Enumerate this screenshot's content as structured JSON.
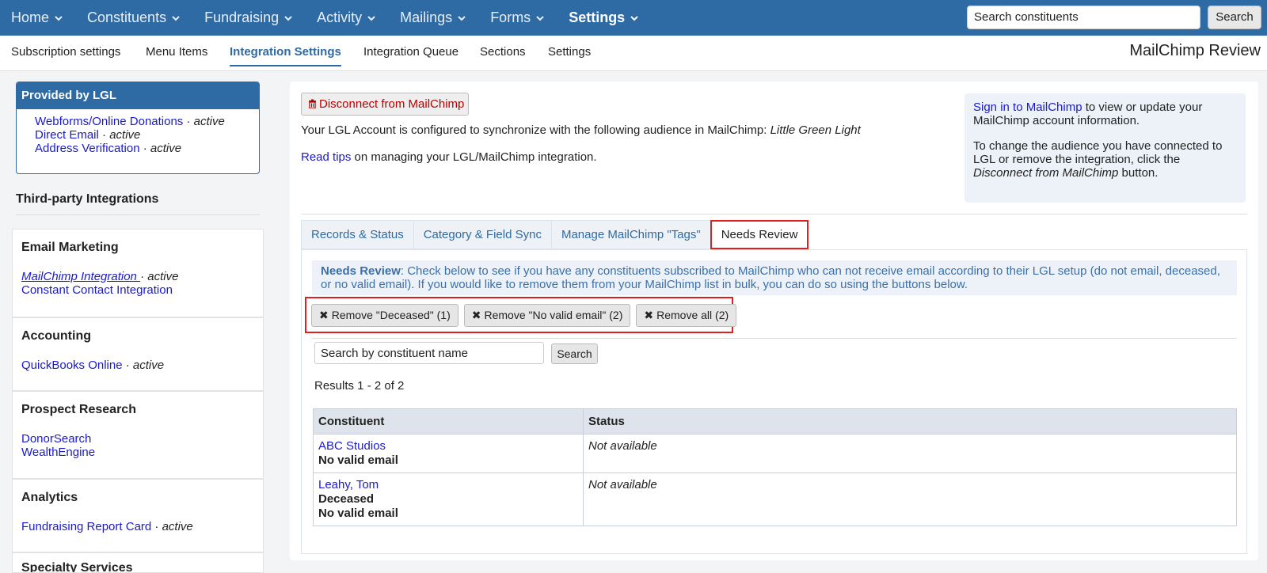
{
  "topnav": {
    "items": [
      {
        "label": "Home"
      },
      {
        "label": "Constituents"
      },
      {
        "label": "Fundraising"
      },
      {
        "label": "Activity"
      },
      {
        "label": "Mailings"
      },
      {
        "label": "Forms"
      },
      {
        "label": "Settings"
      }
    ],
    "search_value": "Search constituents",
    "search_button": "Search"
  },
  "subnav": {
    "items": [
      {
        "label": "Subscription settings"
      },
      {
        "label": "Menu Items"
      },
      {
        "label": "Integration Settings"
      },
      {
        "label": "Integration Queue"
      },
      {
        "label": "Sections"
      },
      {
        "label": "Settings"
      }
    ],
    "page_title": "MailChimp Review"
  },
  "sidebar": {
    "provided": {
      "title": "Provided by LGL",
      "items": [
        {
          "name": "Webforms/Online Donations",
          "sep": " · ",
          "state": "active"
        },
        {
          "name": "Direct Email",
          "sep": " · ",
          "state": "active"
        },
        {
          "name": "Address Verification",
          "sep": " · ",
          "state": "active"
        }
      ]
    },
    "third_party_title": "Third-party Integrations",
    "panels": [
      {
        "title": "Email Marketing",
        "items": [
          {
            "name": "MailChimp Integration ",
            "sep": "· ",
            "state": "active"
          },
          {
            "name": "Constant Contact Integration",
            "sep": "",
            "state": ""
          }
        ]
      },
      {
        "title": "Accounting",
        "items": [
          {
            "name": "QuickBooks Online",
            "sep": " · ",
            "state": "active"
          }
        ]
      },
      {
        "title": "Prospect Research",
        "items": [
          {
            "name": "DonorSearch",
            "sep": "",
            "state": ""
          },
          {
            "name": "WealthEngine",
            "sep": "",
            "state": ""
          }
        ]
      },
      {
        "title": "Analytics",
        "items": [
          {
            "name": "Fundraising Report Card",
            "sep": " · ",
            "state": "active"
          }
        ]
      },
      {
        "title": "Specialty Services",
        "items": []
      }
    ]
  },
  "main": {
    "disconnect_label": "Disconnect from MailChimp",
    "config_prefix": "Your LGL Account is configured to synchronize with the following audience in MailChimp: ",
    "config_audience": "Little Green Light",
    "tips_link": "Read tips",
    "tips_suffix": " on managing your LGL/MailChimp integration.",
    "side_note": {
      "link": "Sign in to MailChimp",
      "line1_suffix": " to view or update your MailChimp account information.",
      "line2_prefix": "To change the audience you have connected to LGL or remove the integration, click the ",
      "line2_em": "Disconnect from MailChimp",
      "line2_suffix": " button."
    },
    "tabs": [
      {
        "label": "Records & Status"
      },
      {
        "label": "Category & Field Sync"
      },
      {
        "label": "Manage MailChimp \"Tags\""
      },
      {
        "label": "Needs Review"
      }
    ],
    "review": {
      "note_title": "Needs Review",
      "note_text": ": Check below to see if you have any constituents subscribed to MailChimp who can not receive email according to their LGL setup (do not email, deceased, or no valid email). If you would like to remove them from your MailChimp list in bulk, you can do so using the buttons below.",
      "buttons": [
        {
          "label": "Remove \"Deceased\" (1)"
        },
        {
          "label": "Remove \"No valid email\" (2)"
        },
        {
          "label": "Remove all (2)"
        }
      ],
      "search_value": "Search by constituent name",
      "search_button": "Search",
      "results": "Results 1 - 2 of 2",
      "table": {
        "headers": [
          "Constituent",
          "Status"
        ],
        "rows": [
          {
            "name": "ABC Studios",
            "flags": [
              "No valid email"
            ],
            "status": "Not available"
          },
          {
            "name": "Leahy, Tom",
            "flags": [
              "Deceased",
              "No valid email"
            ],
            "status": "Not available"
          }
        ]
      }
    }
  }
}
